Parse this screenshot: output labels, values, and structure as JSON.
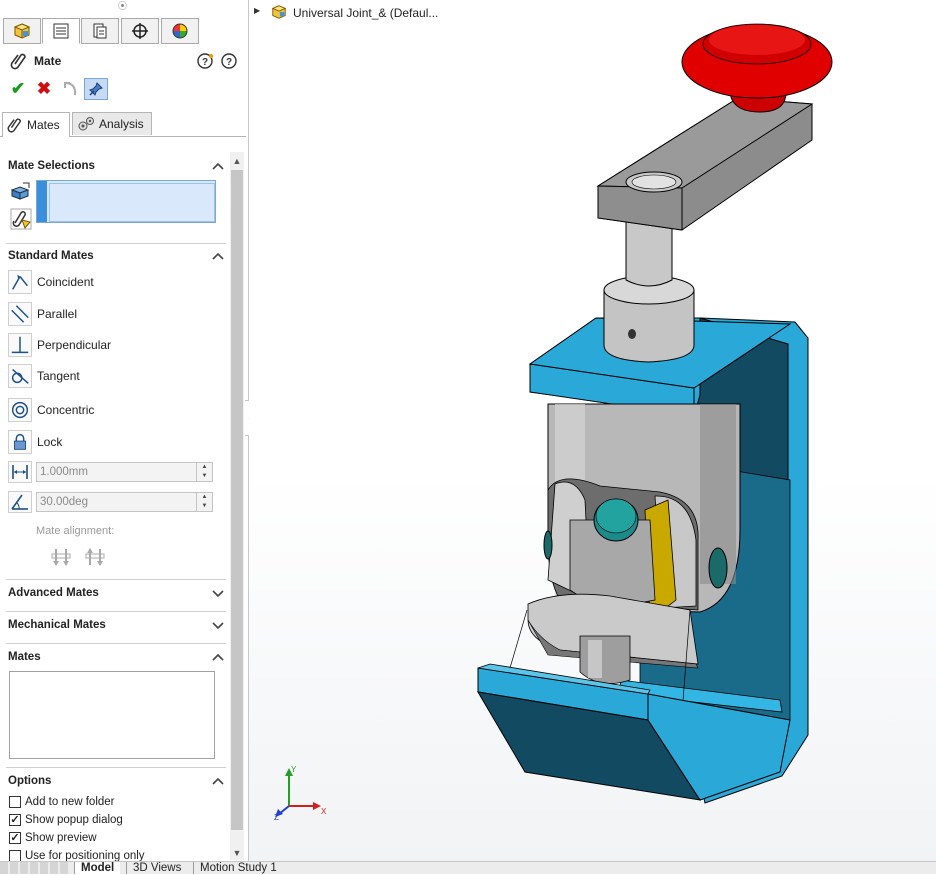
{
  "property_manager": {
    "title": "Mate",
    "subtabs": {
      "mates": "Mates",
      "analysis": "Analysis"
    },
    "sections": {
      "mate_selections": "Mate Selections",
      "standard_mates": "Standard Mates",
      "advanced_mates": "Advanced Mates",
      "mechanical_mates": "Mechanical Mates",
      "mates": "Mates",
      "options": "Options"
    },
    "standard_mates": {
      "coincident": "Coincident",
      "parallel": "Parallel",
      "perpendicular": "Perpendicular",
      "tangent": "Tangent",
      "concentric": "Concentric",
      "lock": "Lock"
    },
    "distance_value": "1.000mm",
    "angle_value": "30.00deg",
    "mate_alignment_label": "Mate alignment:",
    "options": {
      "add_to_new_folder": {
        "label": "Add to new folder",
        "checked": false
      },
      "show_popup_dialog": {
        "label": "Show popup dialog",
        "checked": true
      },
      "show_preview": {
        "label": "Show preview",
        "checked": true
      },
      "use_for_positioning_only": {
        "label": "Use for positioning only",
        "checked": false
      }
    }
  },
  "feature_tree": {
    "item": "Universal Joint_&  (Defaul..."
  },
  "bottom_tabs": {
    "model": "Model",
    "views_3d": "3D Views",
    "motion_study": "Motion Study 1"
  },
  "triad": {
    "x": "X",
    "y": "Y",
    "z": "Z"
  },
  "colors": {
    "accent_blue": "#3e8ede",
    "bracket_blue": "#2aa8d8",
    "knob_red": "#e00000",
    "check_green": "#1a9a1a",
    "cancel_red": "#d01010"
  },
  "icons": [
    "feature-manager-icon",
    "property-manager-icon",
    "configuration-manager-icon",
    "dimxpert-icon",
    "display-manager-icon",
    "paperclip-icon",
    "help-icon",
    "pushpin-icon",
    "ok-check-icon",
    "cancel-x-icon",
    "undo-icon",
    "keep-visible-pin-icon",
    "analysis-gears-icon"
  ]
}
